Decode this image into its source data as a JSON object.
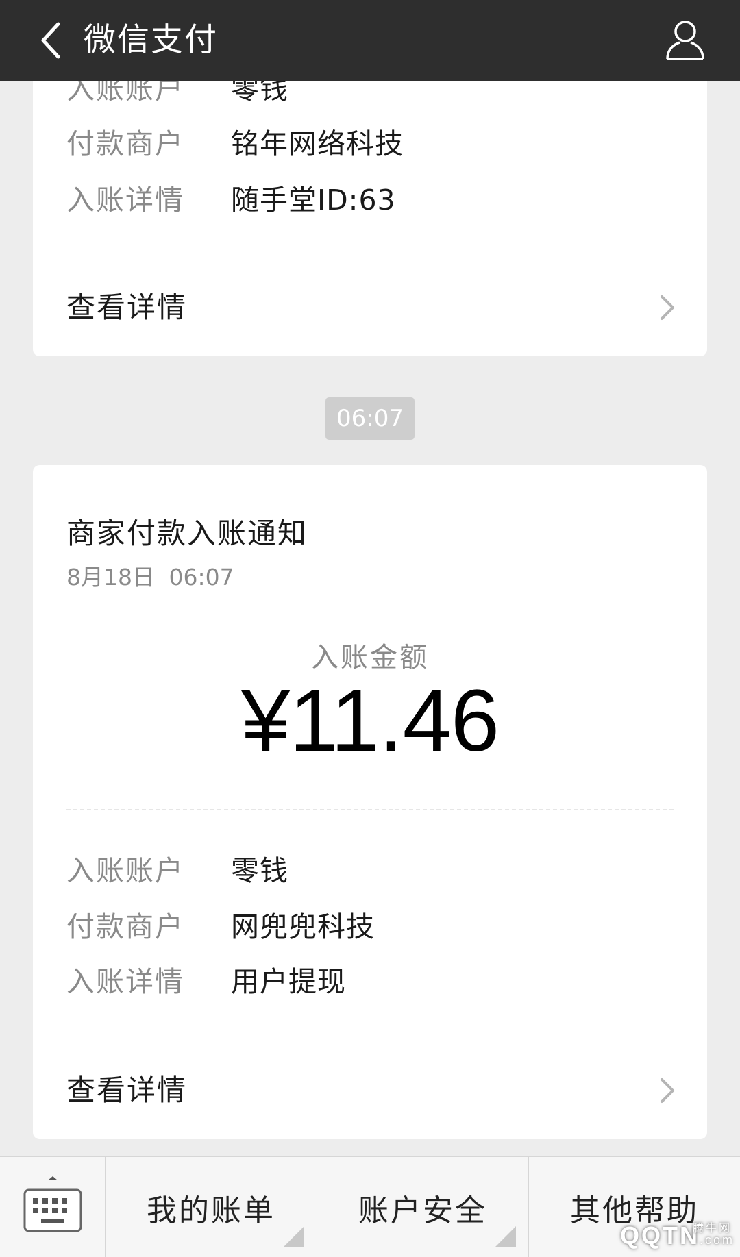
{
  "header": {
    "title": "微信支付",
    "back_icon": "chevron-left-icon",
    "profile_icon": "person-icon"
  },
  "previous_card": {
    "rows": [
      {
        "key": "入账账户",
        "value": "零钱"
      },
      {
        "key": "付款商户",
        "value": "铭年网络科技"
      },
      {
        "key": "入账详情",
        "value": "随手堂ID:63"
      }
    ],
    "detail_label": "查看详情"
  },
  "timestamp": "06:07",
  "main_card": {
    "title": "商家付款入账通知",
    "date": "8月18日 06:07",
    "amount_label": "入账金额",
    "amount": "¥11.46",
    "rows": [
      {
        "key": "入账账户",
        "value": "零钱"
      },
      {
        "key": "付款商户",
        "value": "网兜兜科技"
      },
      {
        "key": "入账详情",
        "value": "用户提现"
      }
    ],
    "detail_label": "查看详情"
  },
  "menu": {
    "keyboard_icon": "keyboard-icon",
    "items": [
      {
        "label": "我的账单"
      },
      {
        "label": "账户安全"
      },
      {
        "label": "其他帮助"
      }
    ]
  },
  "watermark": {
    "text": "QQTN",
    "suffix": ".com",
    "small": "腾牛网"
  },
  "colors": {
    "topbar": "#2e2e2e",
    "background": "#ededed",
    "card": "#ffffff",
    "muted_text": "#8a8a8a"
  }
}
